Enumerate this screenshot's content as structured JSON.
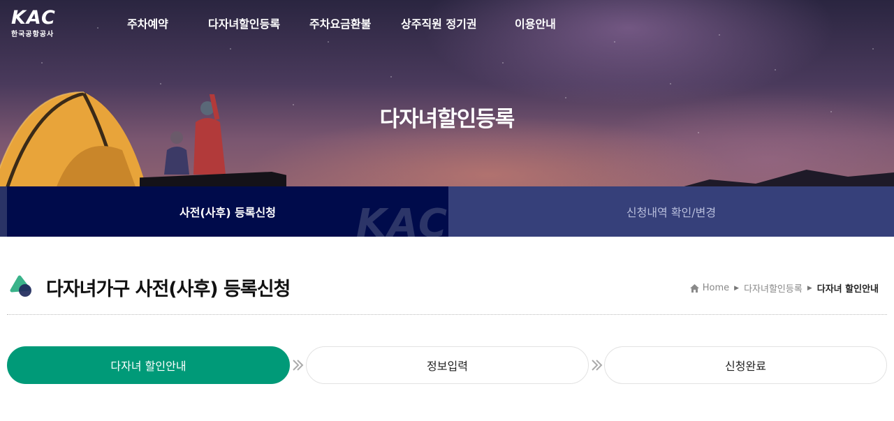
{
  "header": {
    "logo_mark": "KAC",
    "logo_sub": "한국공항공사",
    "nav": [
      {
        "label": "주차예약"
      },
      {
        "label": "다자녀할인등록"
      },
      {
        "label": "주차요금환불"
      },
      {
        "label": "상주직원 정기권"
      },
      {
        "label": "이용안내"
      }
    ]
  },
  "hero": {
    "title": "다자녀할인등록"
  },
  "tabs": [
    {
      "label": "사전(사후) 등록신청",
      "active": true
    },
    {
      "label": "신청내역 확인/변경",
      "active": false
    }
  ],
  "tab_watermark": "KAC",
  "page": {
    "title": "다자녀가구 사전(사후) 등록신청",
    "breadcrumb": [
      {
        "label": "Home",
        "icon": "home-icon"
      },
      {
        "label": "다자녀할인등록"
      },
      {
        "label": "다자녀 할인안내"
      }
    ]
  },
  "steps": [
    {
      "label": "다자녀 할인안내",
      "active": true
    },
    {
      "label": "정보입력",
      "active": false
    },
    {
      "label": "신청완료",
      "active": false
    }
  ],
  "colors": {
    "tab_active_bg": "#000b4b",
    "tab_inactive_bg": "#36407a",
    "step_active_bg": "#009a78",
    "title_icon_green": "#3ab38a",
    "title_icon_navy": "#1f2a5c"
  }
}
